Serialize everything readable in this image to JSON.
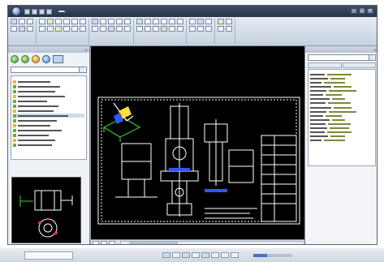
{
  "window": {
    "menu_tabs": [
      "",
      "",
      "",
      "",
      "",
      ""
    ],
    "active_tab_index": 0,
    "title": "",
    "controls": [
      "–",
      "□",
      "×"
    ]
  },
  "ribbon": {
    "groups": [
      {
        "label": ""
      },
      {
        "label": ""
      },
      {
        "label": ""
      },
      {
        "label": ""
      },
      {
        "label": ""
      },
      {
        "label": ""
      }
    ]
  },
  "left_panel": {
    "title": "",
    "path": "",
    "tree_caption": "",
    "tree_rows": 14,
    "selected_row": 7,
    "preview_title": ""
  },
  "drawing": {
    "background": "#000000",
    "line_color": "#ffffff",
    "accent_colors": [
      "#33cc33",
      "#3355ff",
      "#ffdd33",
      "#ff3333"
    ]
  },
  "layout_tabs": [
    "",
    "",
    ""
  ],
  "right_panel": {
    "title": "",
    "entity_select": "",
    "tabs": [
      "",
      ""
    ],
    "sections": [
      {
        "name": ""
      },
      {
        "name": ""
      }
    ]
  },
  "statusbar": {
    "coords": "",
    "zoom_fraction": 0.35
  }
}
